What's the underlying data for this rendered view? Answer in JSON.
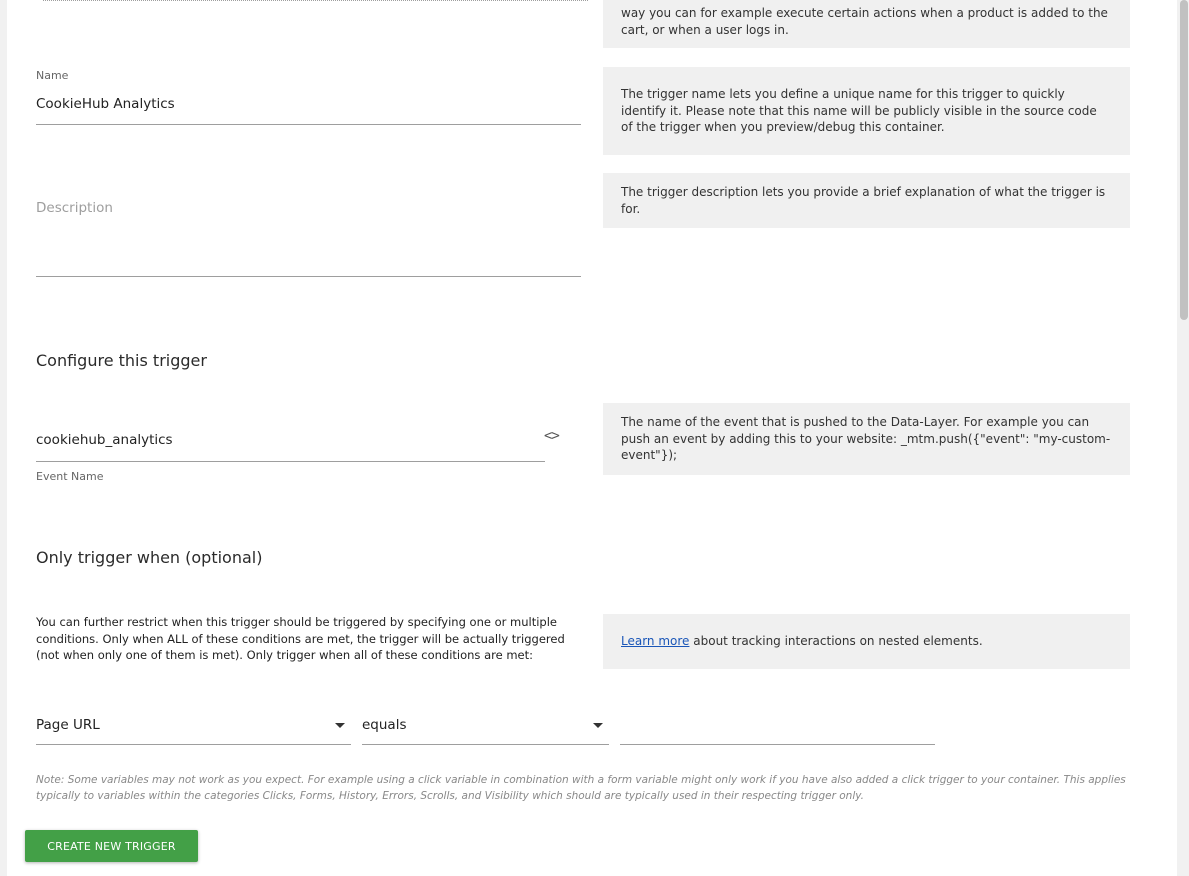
{
  "help": {
    "top_partial": "way you can for example execute certain actions when a product is added to the cart, or when a user logs in.",
    "name": "The trigger name lets you define a unique name for this trigger to quickly identify it. Please note that this name will be publicly visible in the source code of the trigger when you preview/debug this container.",
    "description": "The trigger description lets you provide a brief explanation of what the trigger is for.",
    "event_name": "The name of the event that is pushed to the Data-Layer. For example you can push an event by adding this to your website: _mtm.push({\"event\": \"my-custom-event\"});",
    "learn_more_link": "Learn more",
    "learn_more_rest": " about tracking interactions on nested elements."
  },
  "form": {
    "name_label": "Name",
    "name_value": "CookieHub Analytics",
    "description_placeholder": "Description",
    "configure_title": "Configure this trigger",
    "event_name_value": "cookiehub_analytics",
    "event_name_label": "Event Name",
    "variable_icon": "code-icon",
    "conditions_title": "Only trigger when (optional)",
    "conditions_text": "You can further restrict when this trigger should be triggered by specifying one or multiple conditions. Only when ALL of these conditions are met, the trigger will be actually triggered (not when only one of them is met). Only trigger when all of these conditions are met:",
    "condition": {
      "variable": "Page URL",
      "comparison": "equals",
      "value": ""
    },
    "note": "Note: Some variables may not work as you expect. For example using a click variable in combination with a form variable might only work if you have also added a click trigger to your container. This applies typically to variables within the categories Clicks, Forms, History, Errors, Scrolls, and Visibility which should are typically used in their respecting trigger only.",
    "create_button": "CREATE NEW TRIGGER"
  },
  "colors": {
    "button": "#43a047",
    "help_bg": "#f0f0f0",
    "link": "#1a56b8"
  }
}
